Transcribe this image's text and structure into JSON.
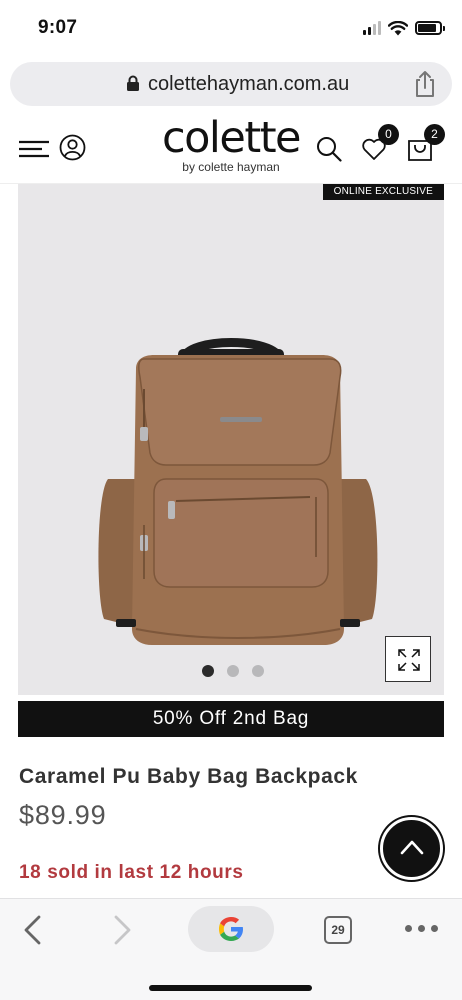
{
  "status_bar": {
    "time": "9:07"
  },
  "browser": {
    "url": "colettehayman.com.au",
    "tab_count": "29"
  },
  "header": {
    "logo_text": "colette",
    "logo_subtext": "by colette hayman",
    "wishlist_count": "0",
    "cart_count": "2"
  },
  "gallery": {
    "tag": "ONLINE EXCLUSIVE",
    "slide_count": 3,
    "active_slide": 1
  },
  "product": {
    "promo": "50% Off 2nd Bag",
    "title": "Caramel Pu Baby Bag Backpack",
    "price": "$89.99",
    "sold_notice": "18 sold in last 12 hours"
  },
  "colors": {
    "accent_black": "#111111",
    "sold_red": "#b23a3f",
    "bag_caramel": "#9c7150"
  },
  "icons": {
    "menu": "hamburger-icon",
    "account": "user-icon",
    "search": "search-icon",
    "wishlist": "heart-icon",
    "cart": "bag-icon",
    "expand": "expand-icon",
    "scroll_top": "chevron-up-icon",
    "share": "share-icon",
    "lock": "lock-icon"
  }
}
